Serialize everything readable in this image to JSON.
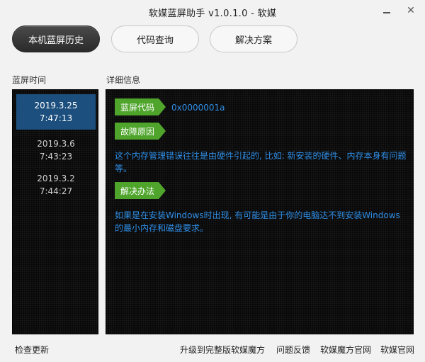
{
  "window": {
    "title": "软媒蓝屏助手 v1.0.1.0 - 软媒",
    "minimize_glyph": "",
    "close_glyph": "✕"
  },
  "tabs": [
    {
      "label": "本机蓝屏历史",
      "active": true
    },
    {
      "label": "代码查询",
      "active": false
    },
    {
      "label": "解决方案",
      "active": false
    }
  ],
  "history": {
    "header": "蓝屏时间",
    "items": [
      {
        "date": "2019.3.25",
        "time": "7:47:13",
        "selected": true
      },
      {
        "date": "2019.3.6",
        "time": "7:43:23",
        "selected": false
      },
      {
        "date": "2019.3.2",
        "time": "7:44:27",
        "selected": false
      }
    ]
  },
  "detail": {
    "header": "详细信息",
    "code_tag": "蓝屏代码",
    "code_value": "0x0000001a",
    "cause_tag": "故障原因",
    "cause_text": "这个内存管理错误往往是由硬件引起的, 比如: 新安装的硬件、内存本身有问题等。",
    "solution_tag": "解决办法",
    "solution_text": "如果是在安装Windows时出现, 有可能是由于你的电脑达不到安装Windows的最小内存和磁盘要求。"
  },
  "footer": {
    "check_update": "检查更新",
    "upgrade": "升级到完整版软媒魔方",
    "feedback": "问题反馈",
    "site": "软媒魔方官网",
    "official": "软媒官网"
  },
  "colors": {
    "accent_green": "#4fa52c",
    "text_blue": "#2f8ee6",
    "selected_blue": "#1c4f7e",
    "panel_bg": "#080808"
  }
}
